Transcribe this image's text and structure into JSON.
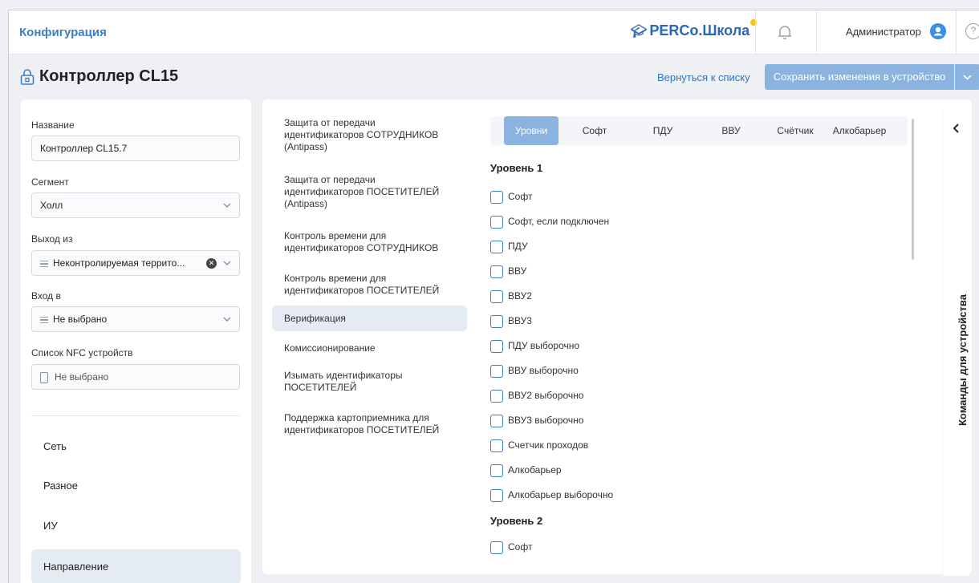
{
  "topbar": {
    "section_title": "Конфигурация",
    "logo_text": "PERCo.Школа",
    "user_name": "Администратор",
    "help": "?",
    "logo_dot_color": "#f6c21b"
  },
  "header": {
    "title": "Контроллер CL15",
    "back_link": "Вернуться к списку",
    "save_button": "Сохранить изменения в устройство"
  },
  "left": {
    "name_label": "Название",
    "name_value": "Контроллер CL15.7",
    "segment_label": "Сегмент",
    "segment_value": "Холл",
    "exit_label": "Выход из",
    "exit_value": "Неконтролируемая террито...",
    "entry_label": "Вход в",
    "entry_value": "Не выбрано",
    "nfc_label": "Список NFC устройств",
    "nfc_placeholder": "Не выбрано",
    "nav": [
      {
        "label": "Сеть"
      },
      {
        "label": "Разное"
      },
      {
        "label": "ИУ"
      },
      {
        "label": "Направление"
      }
    ]
  },
  "menu": [
    {
      "label": "Защита от передачи идентификаторов СОТРУДНИКОВ (Antipass)"
    },
    {
      "label": "Защита от передачи идентификаторов ПОСЕТИТЕЛЕЙ (Antipass)"
    },
    {
      "label": "Контроль времени для идентификаторов СОТРУДНИКОВ"
    },
    {
      "label": "Контроль времени для идентификаторов ПОСЕТИТЕЛЕЙ"
    },
    {
      "label": "Верификация"
    },
    {
      "label": "Комиссионирование"
    },
    {
      "label": "Изымать идентификаторы ПОСЕТИТЕЛЕЙ"
    },
    {
      "label": "Поддержка картоприемника для идентификаторов ПОСЕТИТЕЛЕЙ"
    }
  ],
  "tabs": [
    {
      "label": "Уровни"
    },
    {
      "label": "Софт"
    },
    {
      "label": "ПДУ"
    },
    {
      "label": "ВВУ"
    },
    {
      "label": "Счётчик"
    },
    {
      "label": "Алкобарьер"
    }
  ],
  "level1": {
    "title": "Уровень 1",
    "items": [
      {
        "label": "Софт"
      },
      {
        "label": "Софт, если подключен"
      },
      {
        "label": "ПДУ"
      },
      {
        "label": "ВВУ"
      },
      {
        "label": "ВВУ2"
      },
      {
        "label": "ВВУ3"
      },
      {
        "label": "ПДУ выборочно"
      },
      {
        "label": "ВВУ выборочно"
      },
      {
        "label": "ВВУ2 выборочно"
      },
      {
        "label": "ВВУ3 выборочно"
      },
      {
        "label": "Счетчик проходов"
      },
      {
        "label": "Алкобарьер"
      },
      {
        "label": "Алкобарьер выборочно"
      }
    ]
  },
  "level2": {
    "title": "Уровень 2",
    "items": [
      {
        "label": "Софт"
      }
    ]
  },
  "side_panel": {
    "label": "Команды для устройства"
  },
  "colors": {
    "accent": "#3b7fc4",
    "button": "#8ab3e0",
    "active_bg": "#e5ebf2"
  }
}
